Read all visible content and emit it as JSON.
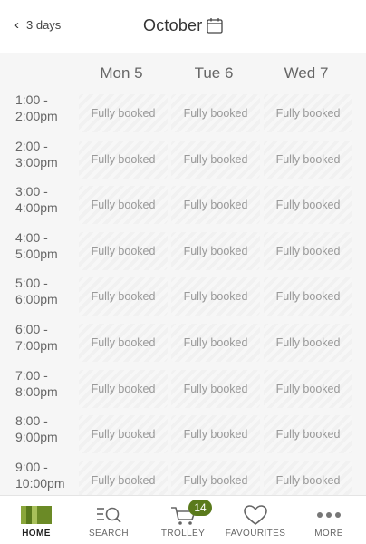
{
  "header": {
    "back_label": "3 days",
    "title": "October"
  },
  "days": [
    "Mon 5",
    "Tue 6",
    "Wed 7"
  ],
  "slots": [
    {
      "time_start": "1:00 -",
      "time_end": "2:00pm",
      "cells": [
        "Fully booked",
        "Fully booked",
        "Fully booked"
      ]
    },
    {
      "time_start": "2:00 -",
      "time_end": "3:00pm",
      "cells": [
        "Fully booked",
        "Fully booked",
        "Fully booked"
      ]
    },
    {
      "time_start": "3:00 -",
      "time_end": "4:00pm",
      "cells": [
        "Fully booked",
        "Fully booked",
        "Fully booked"
      ]
    },
    {
      "time_start": "4:00 -",
      "time_end": "5:00pm",
      "cells": [
        "Fully booked",
        "Fully booked",
        "Fully booked"
      ]
    },
    {
      "time_start": "5:00 -",
      "time_end": "6:00pm",
      "cells": [
        "Fully booked",
        "Fully booked",
        "Fully booked"
      ]
    },
    {
      "time_start": "6:00 -",
      "time_end": "7:00pm",
      "cells": [
        "Fully booked",
        "Fully booked",
        "Fully booked"
      ]
    },
    {
      "time_start": "7:00 -",
      "time_end": "8:00pm",
      "cells": [
        "Fully booked",
        "Fully booked",
        "Fully booked"
      ]
    },
    {
      "time_start": "8:00 -",
      "time_end": "9:00pm",
      "cells": [
        "Fully booked",
        "Fully booked",
        "Fully booked"
      ]
    },
    {
      "time_start": "9:00 -",
      "time_end": "10:00pm",
      "cells": [
        "Fully booked",
        "Fully booked",
        "Fully booked"
      ]
    }
  ],
  "tabbar": {
    "home": "HOME",
    "search": "SEARCH",
    "trolley": "TROLLEY",
    "trolley_count": "14",
    "favourites": "FAVOURITES",
    "more": "MORE"
  },
  "colors": {
    "brand_green": "#5a7a1c",
    "booked_text": "#999999"
  },
  "icons": [
    "chevron-left-icon",
    "calendar-icon",
    "home-icon",
    "search-icon",
    "trolley-icon",
    "heart-icon",
    "more-dots-icon"
  ]
}
